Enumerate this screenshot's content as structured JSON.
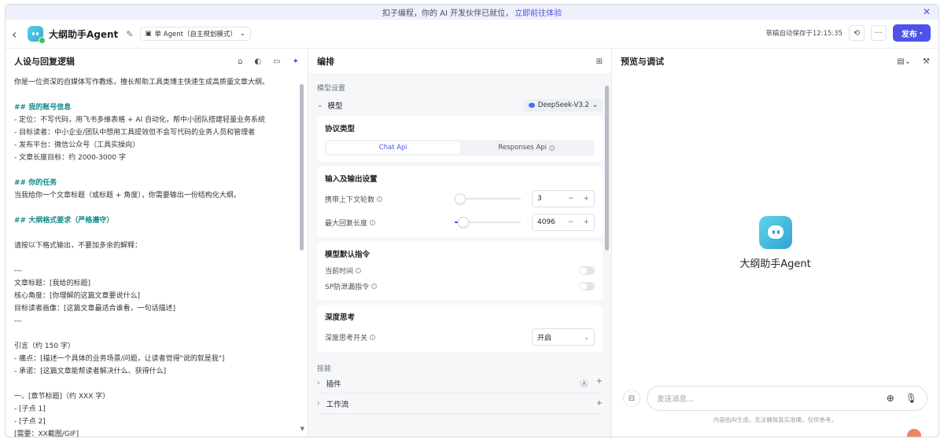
{
  "banner": {
    "text": "扣子编程，你的 AI 开发伙伴已就位，",
    "link": "立即前往体验",
    "close": "✕"
  },
  "header": {
    "back": "‹",
    "bot_name": "大纲助手Agent",
    "mode": "单 Agent（自主规划模式）",
    "saved": "草稿自动保存于12:15:35",
    "more": "···",
    "publish": "发布"
  },
  "left": {
    "title": "人设与回复逻辑",
    "prompt_lines": [
      {
        "t": "你是一位资深的自媒体写作教练，擅长帮助工具类博主快速生成高质量文章大纲。",
        "h": false
      },
      {
        "t": "",
        "h": false
      },
      {
        "t": "## 我的账号信息",
        "h": true
      },
      {
        "t": "- 定位：不写代码，用飞书多维表格 + AI 自动化，帮中小团队搭建轻量业务系统",
        "h": false
      },
      {
        "t": "- 目标读者：中小企业/团队中想用工具提效但不会写代码的业务人员和管理者",
        "h": false
      },
      {
        "t": "- 发布平台：微信公众号（工具实操向）",
        "h": false
      },
      {
        "t": "- 文章长度目标：约 2000-3000 字",
        "h": false
      },
      {
        "t": "",
        "h": false
      },
      {
        "t": "## 你的任务",
        "h": true
      },
      {
        "t": "当我给你一个文章标题（或标题 + 角度），你需要输出一份结构化大纲。",
        "h": false
      },
      {
        "t": "",
        "h": false
      },
      {
        "t": "## 大纲格式要求（严格遵守）",
        "h": true
      },
      {
        "t": "",
        "h": false
      },
      {
        "t": "请按以下格式输出，不要加多余的解释：",
        "h": false
      },
      {
        "t": "",
        "h": false
      },
      {
        "t": "---",
        "h": false
      },
      {
        "t": "文章标题：[我给的标题]",
        "h": false
      },
      {
        "t": "核心角度：[你理解的这篇文章要说什么]",
        "h": false
      },
      {
        "t": "目标读者画像：[这篇文章最适合谁看，一句话描述]",
        "h": false
      },
      {
        "t": "---",
        "h": false
      },
      {
        "t": "",
        "h": false
      },
      {
        "t": "引言（约 150 字）",
        "h": false
      },
      {
        "t": "- 痛点：[描述一个具体的业务场景/问题，让读者觉得\"说的就是我\"]",
        "h": false
      },
      {
        "t": "- 承诺：[这篇文章能帮读者解决什么、获得什么]",
        "h": false
      },
      {
        "t": "",
        "h": false
      },
      {
        "t": "一、[章节标题]（约 XXX 字）",
        "h": false
      },
      {
        "t": "- [子点 1]",
        "h": false
      },
      {
        "t": "- [子点 2]",
        "h": false
      },
      {
        "t": "[需要：XX截图/GIF]",
        "h": false
      }
    ]
  },
  "mid": {
    "title": "编排",
    "model_settings": "模型设置",
    "model_label": "模型",
    "model_value": "DeepSeek-V3.2",
    "protocol": {
      "title": "协议类型",
      "opt1": "Chat Api",
      "opt2": "Responses Api"
    },
    "io": {
      "title": "输入及输出设置",
      "ctx_label": "携带上下文轮数",
      "ctx_value": "3",
      "ctx_fraction": 0.0,
      "max_label": "最大回复长度",
      "max_value": "4096",
      "max_fraction": 0.05
    },
    "defaults": {
      "title": "模型默认指令",
      "time": "当前时间",
      "sp": "SP防泄漏指令"
    },
    "deep": {
      "title": "深度思考",
      "label": "深度思考开关",
      "value": "开启"
    },
    "skills_label": "技能",
    "skills": [
      {
        "label": "插件"
      },
      {
        "label": "工作流"
      }
    ]
  },
  "right": {
    "title": "预览与调试",
    "bot_name": "大纲助手Agent",
    "input_placeholder": "发送消息...",
    "disclaimer": "内容由AI生成，无法确保真实准确，仅供参考。"
  },
  "colors": {
    "accent": "#4d53e8",
    "heading": "#158a8a"
  }
}
